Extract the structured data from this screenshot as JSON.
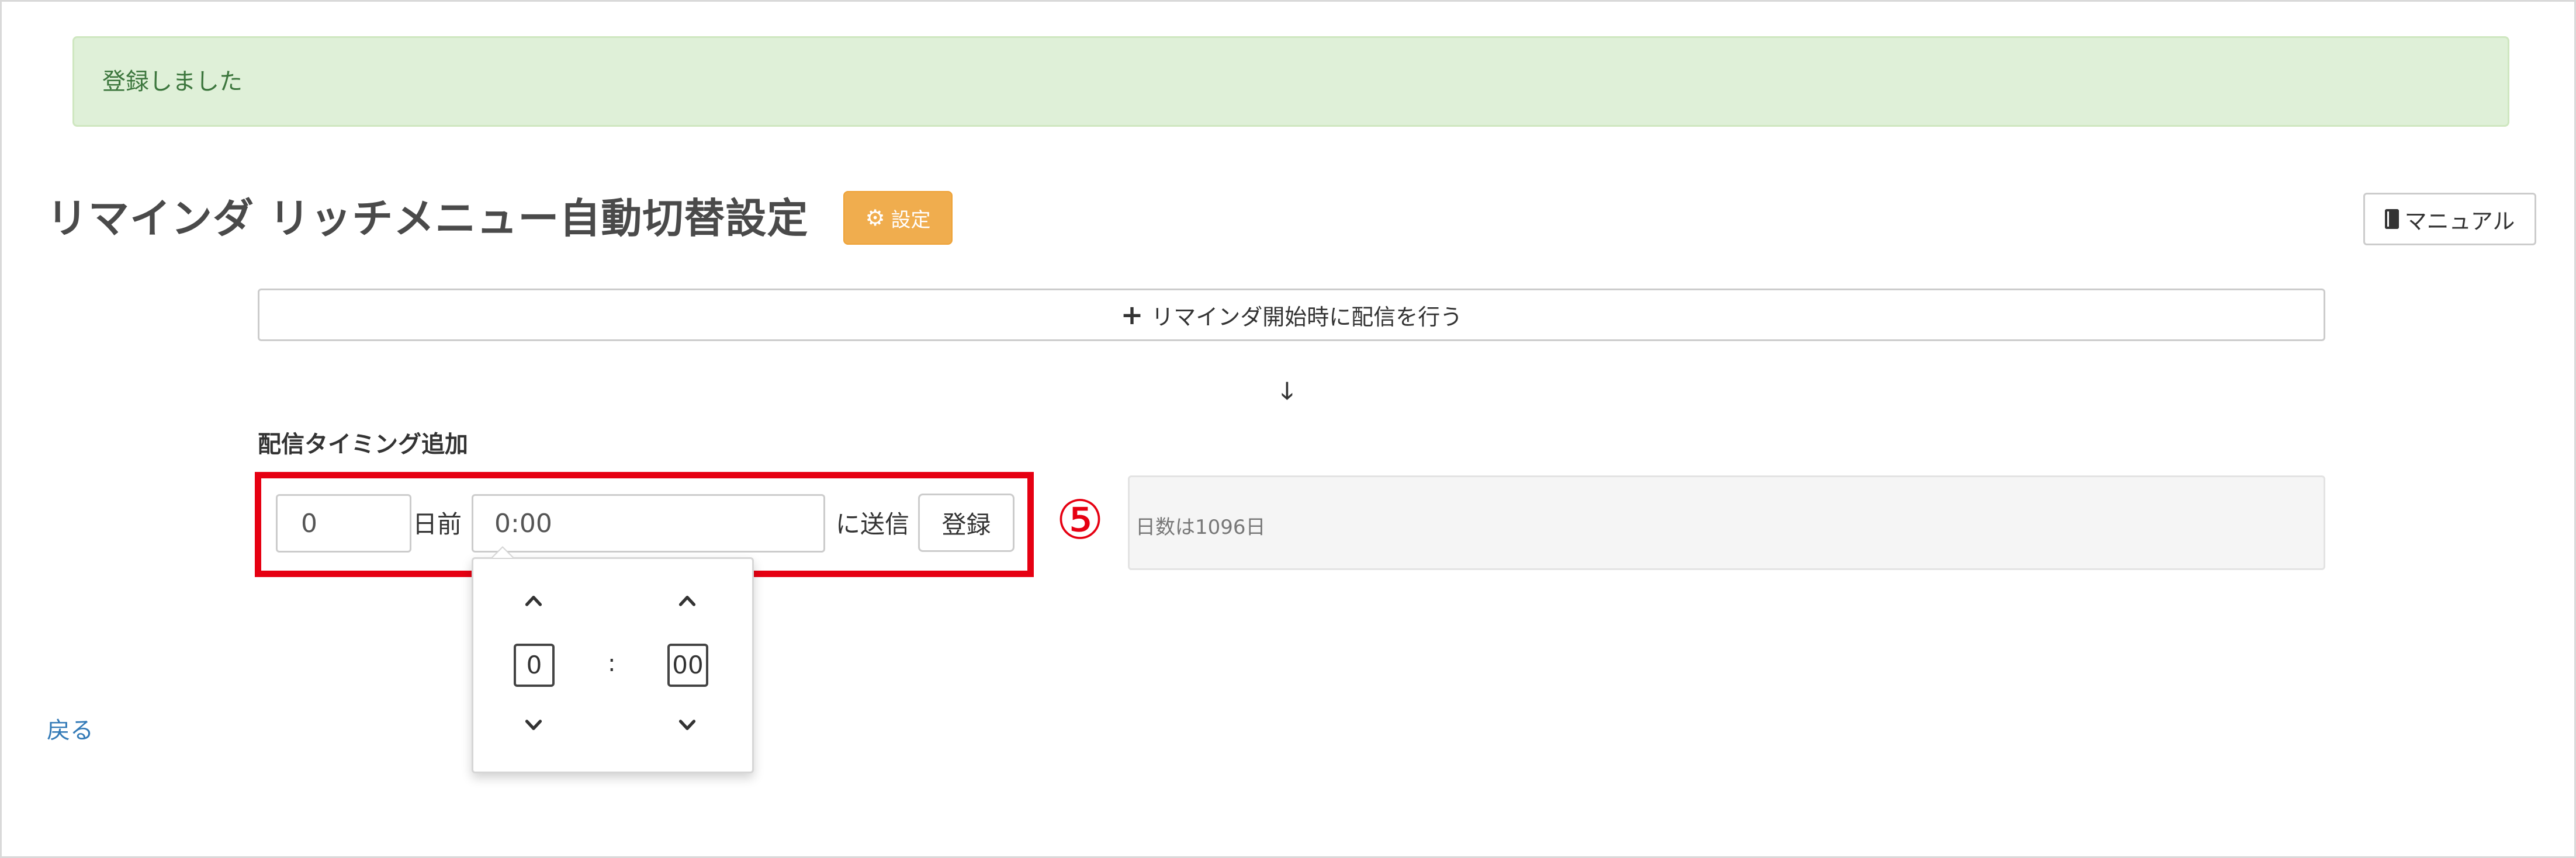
{
  "alert": {
    "message": "登録しました"
  },
  "header": {
    "title": "リマインダ リッチメニュー自動切替設定",
    "settings_label": "設定",
    "manual_label": "マニュアル"
  },
  "main": {
    "add_start_label": "リマインダ開始時に配信を行う",
    "section_label": "配信タイミング追加",
    "form": {
      "days_value": "0",
      "days_suffix": "日前",
      "time_value": "0:00",
      "send_suffix": "に送信",
      "register_label": "登録"
    },
    "info_text": "日数は1096日",
    "callout": "⑤"
  },
  "time_picker": {
    "hour": "0",
    "separator": ":",
    "minute": "00"
  },
  "footer": {
    "back_label": "戻る"
  },
  "colors": {
    "alert_bg": "#dff0d8",
    "alert_text": "#3c763d",
    "warning": "#f0ad4e",
    "highlight": "#e60012",
    "link": "#337ab7"
  }
}
